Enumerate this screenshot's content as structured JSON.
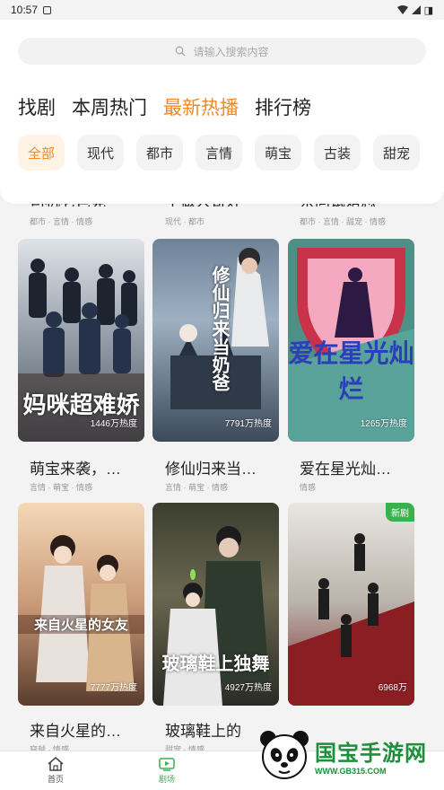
{
  "status_bar": {
    "time": "10:57",
    "battery": "◨"
  },
  "search": {
    "placeholder": "请输入搜索内容"
  },
  "main_tabs": [
    "找剧",
    "本周热门",
    "最新热播",
    "排行榜"
  ],
  "active_main_tab": "最新热播",
  "chips": [
    "全部",
    "现代",
    "都市",
    "言情",
    "萌宝",
    "古装",
    "甜宠"
  ],
  "active_chip": "全部",
  "previous_row": [
    {
      "title": "司机老爸竟",
      "tags": "都市 · 言情 · 情感"
    },
    {
      "title": "不做大哥好",
      "tags": "现代 · 都市"
    },
    {
      "title": "亲同试婚恋",
      "tags": "都市 · 言情 · 甜宠 · 情感"
    }
  ],
  "row1": [
    {
      "title": "萌宝来袭，…",
      "tags": "言情 · 萌宝 · 情感",
      "heat": "1446万热度",
      "caption": "妈咪超难娇",
      "badge": ""
    },
    {
      "title": "修仙归来当…",
      "tags": "言情 · 萌宝 · 情感",
      "heat": "7791万热度",
      "caption": "修仙归来当奶爸",
      "badge": ""
    },
    {
      "title": "爱在星光灿…",
      "tags": "情感",
      "heat": "1265万热度",
      "caption": "爱在星光灿烂",
      "badge": ""
    }
  ],
  "row2": [
    {
      "title": "来自火星的…",
      "tags": "穿越 · 情感",
      "heat": "7777万热度",
      "caption": "来自火星的女友",
      "badge": ""
    },
    {
      "title": "玻璃鞋上的",
      "tags": "甜宠 · 情感",
      "heat": "4927万热度",
      "caption": "玻璃鞋上独舞",
      "badge": ""
    },
    {
      "title": "",
      "tags": "",
      "heat": "6968万",
      "caption": "",
      "badge": "新剧"
    }
  ],
  "bottom_nav": [
    {
      "label": "首页",
      "icon": "home-icon"
    },
    {
      "label": "剧场",
      "icon": "tv-icon"
    }
  ],
  "active_nav": "剧场",
  "watermark": {
    "title": "国宝手游网",
    "url": "WWW.GB315.COM"
  },
  "colors": {
    "accent": "#f08a24",
    "green": "#37b24d"
  }
}
